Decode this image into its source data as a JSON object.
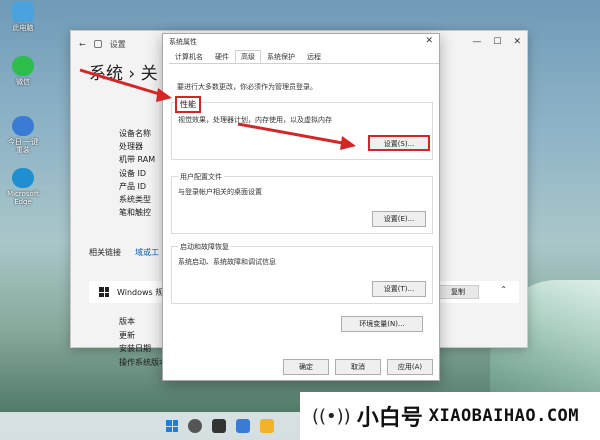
{
  "desktop": {
    "icons": [
      {
        "label": "此电脑",
        "color": "#4aa3df"
      },
      {
        "label": "微信",
        "color": "#2dbd4b"
      },
      {
        "label": "今日·一键\n重装",
        "color": "#3a7bd5"
      },
      {
        "label": "Microsoft\nEdge",
        "color": "#1f8fd1"
      }
    ]
  },
  "settings": {
    "title": "设置",
    "breadcrumb": "系统 › 关",
    "specs": [
      "设备名称",
      "处理器",
      "机带 RAM",
      "设备 ID",
      "产品 ID",
      "系统类型",
      "笔和触控"
    ],
    "related_title": "相关链接",
    "related_link": "域或工",
    "windows_row": "Windows 规",
    "copy_label": "复制",
    "win_specs": [
      "版本",
      "更新",
      "安装日期",
      "操作系统版本"
    ]
  },
  "dialog": {
    "title": "系统属性",
    "tabs": [
      "计算机名",
      "硬件",
      "高级",
      "系统保护",
      "远程"
    ],
    "active_tab": 2,
    "notice": "要进行大多数更改，你必须作为管理员登录。",
    "performance": {
      "label": "性能",
      "desc": "视觉效果，处理器计划，内存使用，以及虚拟内存",
      "button": "设置(S)..."
    },
    "profiles": {
      "label": "用户配置文件",
      "desc": "与登录帐户相关的桌面设置",
      "button": "设置(E)..."
    },
    "startup": {
      "label": "启动和故障恢复",
      "desc": "系统启动、系统故障和调试信息",
      "button": "设置(T)..."
    },
    "env_button": "环境变量(N)...",
    "ok": "确定",
    "cancel": "取消",
    "apply": "应用(A)"
  },
  "watermark": {
    "cn": "小白号",
    "en": "XIAOBAIHAO.COM"
  },
  "colors": {
    "accent_red": "#d62525"
  }
}
